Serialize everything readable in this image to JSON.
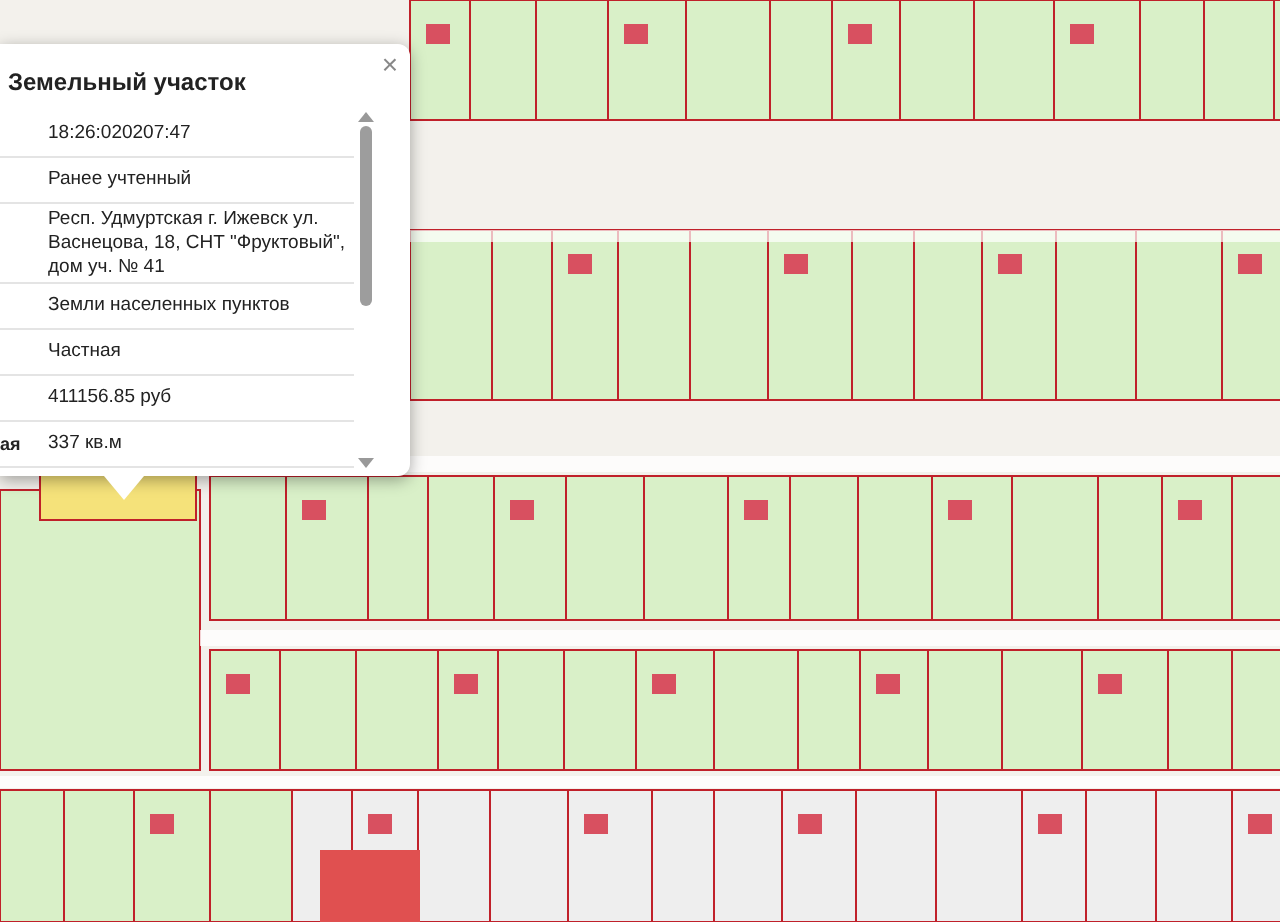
{
  "popup": {
    "title": "Земельный участок",
    "close": "×",
    "rows": [
      {
        "label": "",
        "value": "18:26:020207:47"
      },
      {
        "label": "",
        "value": "Ранее учтенный"
      },
      {
        "label": "",
        "value": "Респ. Удмуртская г. Ижевск ул. Васнецова, 18, СНТ \"Фруктовый\", дом уч. № 41"
      },
      {
        "label": "",
        "value": "Земли населенных пунктов"
      },
      {
        "label": "",
        "value": "Частная"
      },
      {
        "label": "",
        "value": "411156.85 руб"
      },
      {
        "label": "ая",
        "value": "337 кв.м"
      }
    ]
  }
}
